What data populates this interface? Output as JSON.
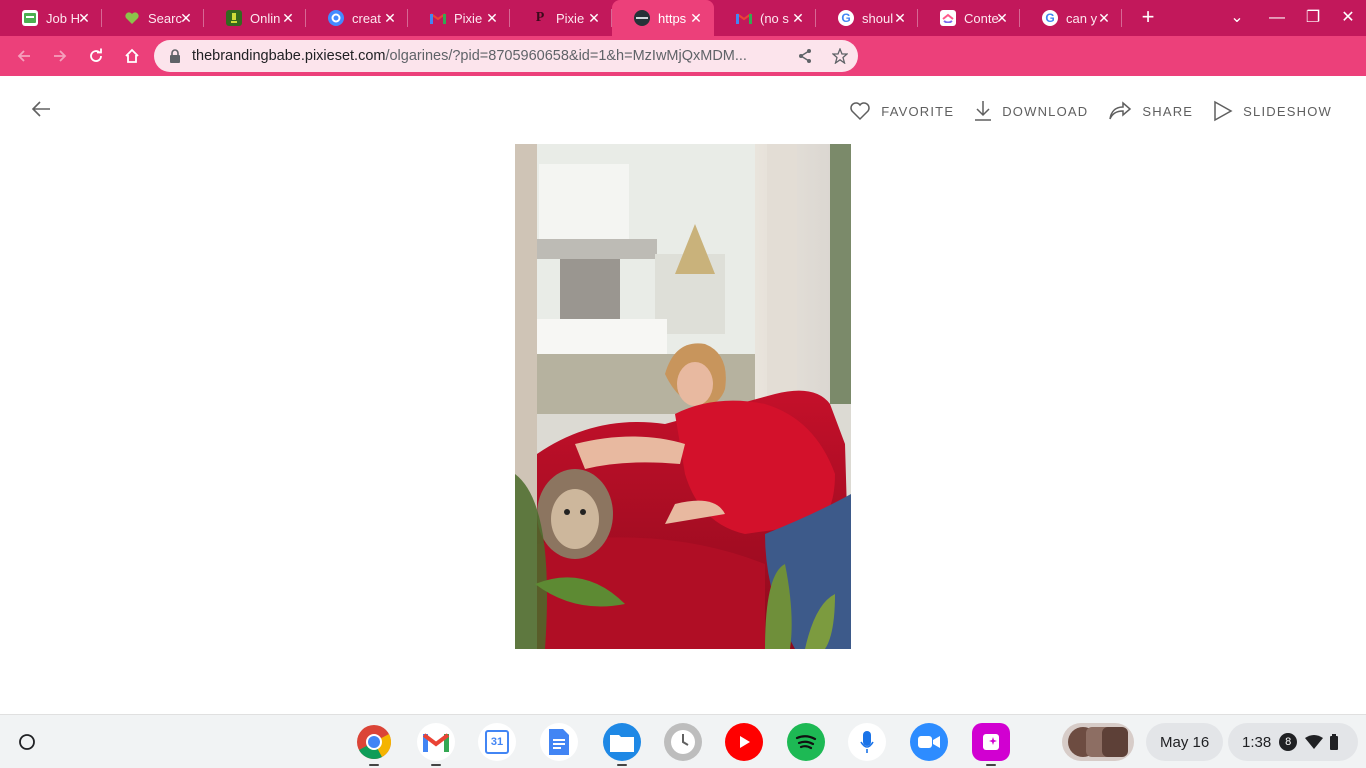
{
  "tabs": [
    {
      "title": "Job H",
      "favicon": "job-favicon",
      "color": "#4caf50"
    },
    {
      "title": "Searc",
      "favicon": "heart-favicon",
      "color": "#8bc34a"
    },
    {
      "title": "Onlin",
      "favicon": "online-favicon",
      "color": "#558b2f"
    },
    {
      "title": "creat",
      "favicon": "create-favicon",
      "color": "#448aff"
    },
    {
      "title": "Pixie",
      "favicon": "gmail-favicon",
      "color": "#ea4335"
    },
    {
      "title": "Pixie",
      "favicon": "pixieset-favicon",
      "color": "#7a1f3d"
    },
    {
      "title": "https",
      "favicon": "site-favicon",
      "color": "#263238"
    },
    {
      "title": "(no s",
      "favicon": "gmail-favicon",
      "color": "#ea4335"
    },
    {
      "title": "shoul",
      "favicon": "google-favicon",
      "color": "#4285f4"
    },
    {
      "title": "Conte",
      "favicon": "clickup-favicon",
      "color": "#7b68ee"
    },
    {
      "title": "can y",
      "favicon": "google-favicon",
      "color": "#4285f4"
    }
  ],
  "active_tab_index": 6,
  "new_tab_label": "+",
  "address_bar": {
    "domain": "thebrandingbabe.pixieset.com",
    "path": "/olgarines/?pid=8705960658&id=1&h=MzIwMjQxMDM..."
  },
  "gallery": {
    "actions": [
      {
        "label": "FAVORITE",
        "icon": "heart-icon"
      },
      {
        "label": "DOWNLOAD",
        "icon": "download-icon"
      },
      {
        "label": "SHARE",
        "icon": "share-icon"
      },
      {
        "label": "SLIDESHOW",
        "icon": "play-icon"
      }
    ]
  },
  "shelf": {
    "apps": [
      "chrome",
      "gmail",
      "calendar",
      "docs",
      "files",
      "clock",
      "youtube",
      "spotify",
      "voice-recorder",
      "zoom",
      "canva"
    ],
    "calendar_day": "31",
    "date": "May 16",
    "time": "1:38",
    "notification_count": "8"
  },
  "colors": {
    "tab_strip": "#c2185b",
    "toolbar": "#ec407a",
    "omnibox": "#fce4ec"
  }
}
